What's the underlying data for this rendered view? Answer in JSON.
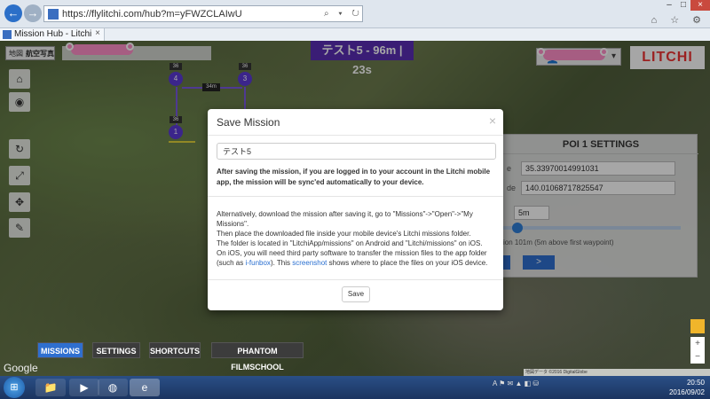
{
  "browser": {
    "url": "https://flylitchi.com/hub?m=yFWZCLAIwU",
    "tab_title": "Mission Hub - Litchi",
    "tab_close": "×",
    "back": "←",
    "forward": "→",
    "addr_tools": "⌕ ▾ ↻",
    "icons": "⌂ ☆ ⚙",
    "minimize": "–",
    "maximize": "□",
    "close": "×"
  },
  "map": {
    "map_type_map": "地図",
    "map_type_satellite": "航空写真",
    "mission_title": "テスト5 - 96m | 23s",
    "logo": "LITCHI",
    "user_caret": "▾",
    "user_icon": "👤",
    "distance_label": "34m",
    "google": "Google",
    "footer": "地図データ ©2016 DigitalGlobe",
    "zoom_in": "+",
    "zoom_out": "−"
  },
  "waypoints": [
    {
      "label": "4",
      "alt": "36"
    },
    {
      "label": "3",
      "alt": "36"
    },
    {
      "label": "1",
      "alt": "36"
    }
  ],
  "controls": {
    "home": "⌂",
    "locate": "◉",
    "refresh": "↻",
    "expand": "⤢",
    "move": "✥",
    "erase": "✎"
  },
  "poi": {
    "title": "POI 1 SETTINGS",
    "lat_label": "e",
    "latitude": "35.33970014991031",
    "lng_label": "de",
    "longitude": "140.01068717825547",
    "altitude": "5m",
    "altitude_note": "ion 101m (5m above first waypoint)",
    "next": ">"
  },
  "tabs": {
    "missions": "MISSIONS",
    "settings": "SETTINGS",
    "shortcuts": "SHORTCUTS",
    "filmschool": "PHANTOM FILMSCHOOL"
  },
  "modal": {
    "title": "Save Mission",
    "close": "×",
    "mission_name": "テスト5",
    "sync_note": "After saving the mission, if you are logged in to your account in the Litchi mobile app, the mission will be sync'ed automatically to your device.",
    "body_line1": "Alternatively, download the mission after saving it, go to \"Missions\"->\"Open\"->\"My Missions\".",
    "body_line2": "Then place the downloaded file inside your mobile device's Litchi missions folder.",
    "body_line3": "The folder is located in \"LitchiApp/missions\" on Android and \"Litchi/missions\" on iOS.",
    "body_line4a": "On iOS, you will need third party software to transfer the mission files to the app folder (such as ",
    "body_link1": "i-funbox",
    "body_line4b": "). This ",
    "body_link2": "screenshot",
    "body_line4c": " shows where to place the files on your iOS device.",
    "save": "Save"
  },
  "taskbar": {
    "start": "⊞",
    "icons": [
      "📁",
      "▶",
      "◍",
      "e"
    ],
    "time": "20:50",
    "date": "2016/09/02",
    "tray": "A ⚑ ✉ ▲ ◧ ⛁"
  }
}
